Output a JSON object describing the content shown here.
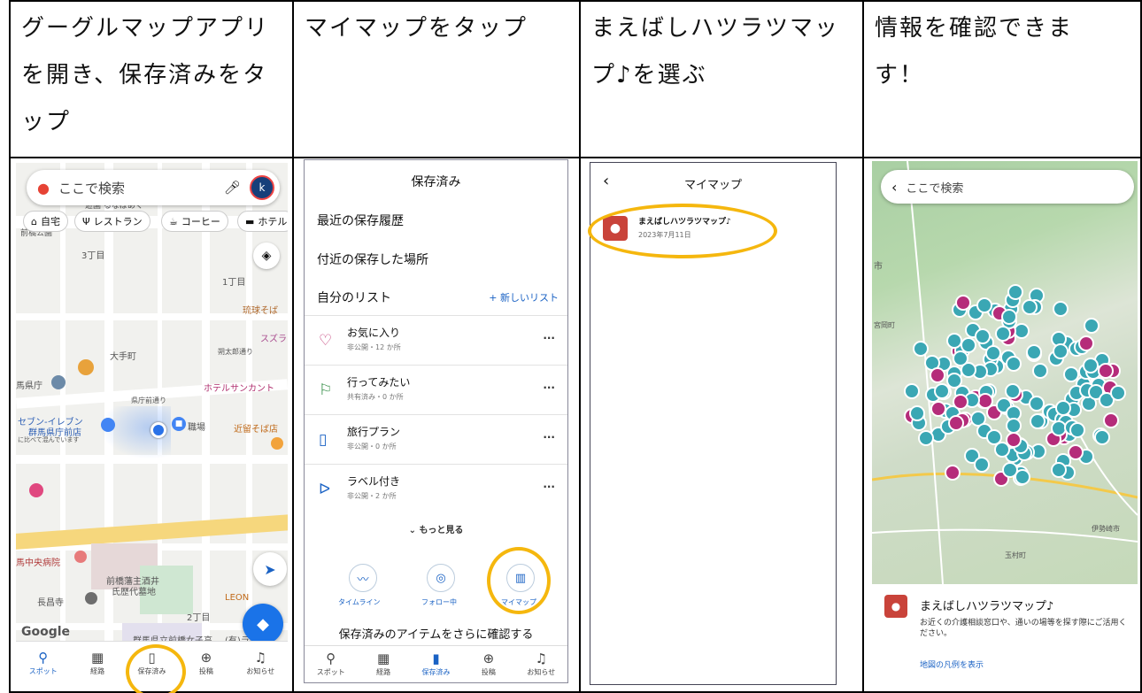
{
  "headers": [
    {
      "lines": [
        "グーグルマップアプリ",
        "を開き、保存済みをタ",
        "ップ"
      ]
    },
    {
      "lines": [
        "マイマップをタップ"
      ]
    },
    {
      "lines": [
        "まえばしハツラツマッ",
        "プ♪を選ぶ"
      ]
    },
    {
      "lines": [
        "情報を確認できま",
        "す！"
      ]
    }
  ],
  "phone1": {
    "search_placeholder": "ここで検索",
    "avatar_letter": "k",
    "chips": [
      "自宅",
      "レストラン",
      "コーヒー",
      "ホテル"
    ],
    "map_labels": [
      "遊園 るなぱあく",
      "前橋公園",
      "3丁目",
      "1丁目",
      "琉球そば",
      "スズラ",
      "大手町",
      "朔太郎通り",
      "馬県庁",
      "県庁前通り",
      "ホテルサンカント",
      "セブン-イレブン",
      "群馬県庁前店",
      "に比べて混んでいます",
      "職場",
      "近留そば店",
      "馬中央病院",
      "前橋藩主酒井",
      "氏歴代墓地",
      "長昌寺",
      "LEON",
      "2丁目",
      "群馬県立前橋女子高",
      "(有)ラケ"
    ],
    "google_logo": "Google",
    "nav": [
      "スポット",
      "経路",
      "保存済み",
      "投稿",
      "お知らせ"
    ]
  },
  "phone2": {
    "title": "保存済み",
    "recent": "最近の保存履歴",
    "nearby": "付近の保存した場所",
    "my_lists": "自分のリスト",
    "new_list": "+ 新しいリスト",
    "lists": [
      {
        "icon": "heart-icon",
        "name": "お気に入り",
        "meta": "非公開・12 か所"
      },
      {
        "icon": "flag-icon",
        "name": "行ってみたい",
        "meta": "共有済み・0 か所"
      },
      {
        "icon": "suitcase-icon",
        "name": "旅行プラン",
        "meta": "非公開・0 か所"
      },
      {
        "icon": "label-icon",
        "name": "ラベル付き",
        "meta": "非公開・2 か所"
      }
    ],
    "more_label": "もっと見る",
    "shortcuts": [
      "タイムライン",
      "フォロー中",
      "マイマップ"
    ],
    "footer_text": "保存済みのアイテムをさらに確認する",
    "nav": [
      "スポット",
      "経路",
      "保存済み",
      "投稿",
      "お知らせ"
    ]
  },
  "phone3": {
    "title": "マイマップ",
    "map_name": "まえばしハツラツマップ♪",
    "map_date": "2023年7月11日"
  },
  "phone4": {
    "search_placeholder": "ここで検索",
    "map_labels": [
      "市",
      "宮岡町",
      "伊勢崎市",
      "玉村町"
    ],
    "card_title": "まえばしハツラツマップ♪",
    "card_desc": "お近くの介護相談窓口や、通いの場等を探す際にご活用ください。",
    "legend_link": "地図の凡例を表示"
  },
  "colors": {
    "highlight_ring": "#f5b70e",
    "accent_blue": "#1a62c4",
    "teal_pin": "#3aa7b4",
    "magenta_pin": "#b52c7a",
    "red_pin": "#c9433a"
  }
}
